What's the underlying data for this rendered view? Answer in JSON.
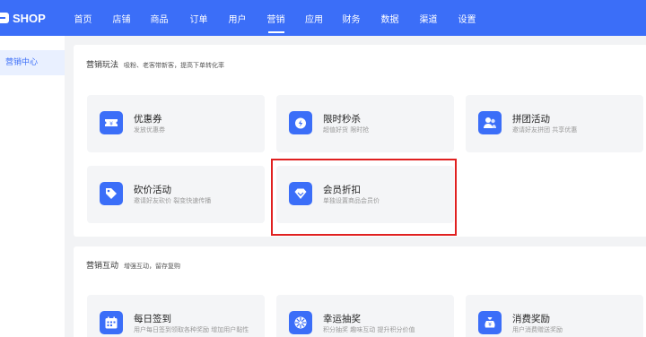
{
  "app": {
    "logo_text": "SHOP"
  },
  "nav": {
    "items": [
      {
        "label": "首页"
      },
      {
        "label": "店铺"
      },
      {
        "label": "商品"
      },
      {
        "label": "订单"
      },
      {
        "label": "用户"
      },
      {
        "label": "营销"
      },
      {
        "label": "应用"
      },
      {
        "label": "财务"
      },
      {
        "label": "数据"
      },
      {
        "label": "渠道"
      },
      {
        "label": "设置"
      }
    ],
    "active": "营销"
  },
  "sidebar": {
    "items": [
      {
        "label": "营销中心"
      }
    ]
  },
  "section1": {
    "title": "营销玩法",
    "subtitle": "吸粉、老客带新客，提高下单转化率",
    "cards": [
      {
        "title": "优惠券",
        "sub": "发放优惠券",
        "icon": "coupon-icon"
      },
      {
        "title": "限时秒杀",
        "sub": "超值好货 限时抢",
        "icon": "flash-sale-icon"
      },
      {
        "title": "拼团活动",
        "sub": "邀请好友拼团 共享优惠",
        "icon": "group-buy-icon"
      },
      {
        "title": "砍价活动",
        "sub": "邀请好友砍价 裂变快速传播",
        "icon": "price-tag-icon"
      },
      {
        "title": "会员折扣",
        "sub": "单独设置商品会员价",
        "icon": "diamond-icon"
      }
    ]
  },
  "section2": {
    "title": "营销互动",
    "subtitle": "增强互动，留存复购",
    "cards": [
      {
        "title": "每日签到",
        "sub": "用户每日签到领取各种奖励 增加用户黏性",
        "icon": "calendar-icon"
      },
      {
        "title": "幸运抽奖",
        "sub": "积分抽奖 趣味互动 提升积分价值",
        "icon": "lottery-wheel-icon"
      },
      {
        "title": "消费奖励",
        "sub": "用户消费赠送奖励",
        "icon": "money-bag-icon"
      }
    ]
  },
  "colors": {
    "primary": "#3b6ef8",
    "highlight": "#e02020"
  }
}
